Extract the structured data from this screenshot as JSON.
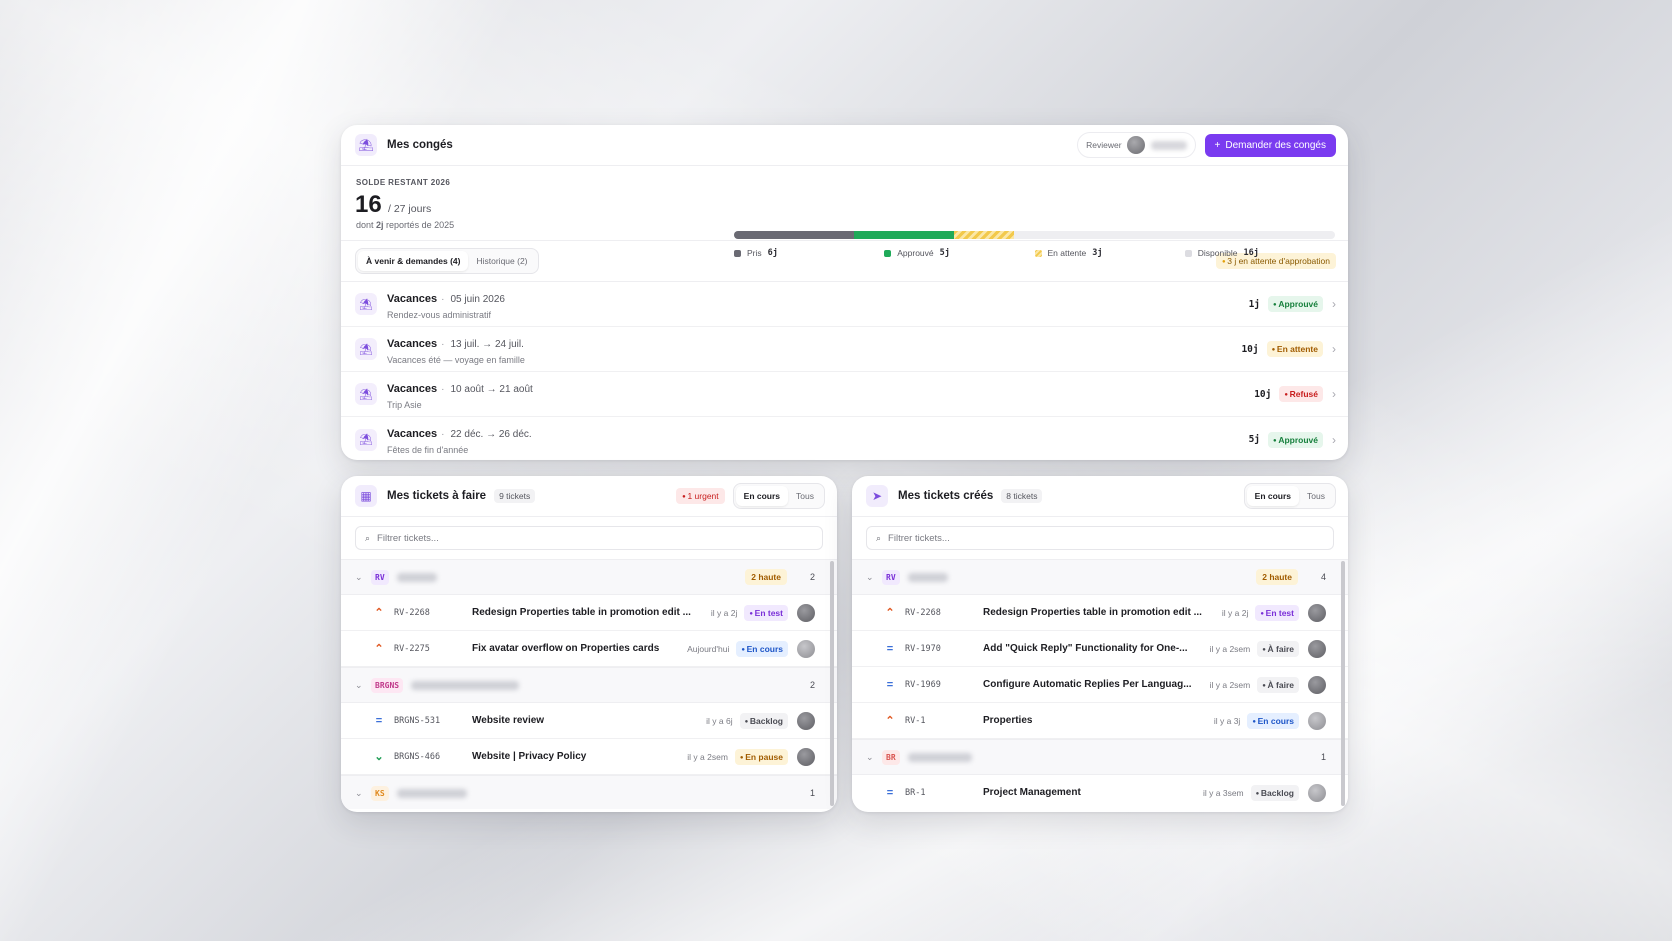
{
  "conges": {
    "title": "Mes congés",
    "reviewer_label": "Reviewer",
    "request_button": "Demander des congés",
    "balance": {
      "caption": "SOLDE RESTANT 2026",
      "remaining": "16",
      "total": "/ 27 jours",
      "carry_prefix": "dont ",
      "carry_value": "2j",
      "carry_suffix": " reportés de 2025"
    },
    "breakdown": [
      {
        "label": "Pris",
        "value": "6j",
        "days": 6,
        "color": "#6a6a73"
      },
      {
        "label": "Approuvé",
        "value": "5j",
        "days": 5,
        "color": "#1faa59"
      },
      {
        "label": "En attente",
        "value": "3j",
        "days": 3,
        "color": "#f2c94c"
      },
      {
        "label": "Disponible",
        "value": "16j",
        "days": 16,
        "color": "#e6e6ea"
      }
    ],
    "tabs": [
      "À venir & demandes (4)",
      "Historique (2)"
    ],
    "pending_note": "3 j en attente d'approbation",
    "requests": [
      {
        "type": "Vacances",
        "date": "05 juin 2026",
        "note": "Rendez-vous administratif",
        "days": "1j",
        "status": "Approuvé",
        "status_kind": "green"
      },
      {
        "type": "Vacances",
        "date": "13 juil. → 24 juil.",
        "note": "Vacances été — voyage en famille",
        "days": "10j",
        "status": "En attente",
        "status_kind": "amber"
      },
      {
        "type": "Vacances",
        "date": "10 août → 21 août",
        "note": "Trip Asie",
        "days": "10j",
        "status": "Refusé",
        "status_kind": "red"
      },
      {
        "type": "Vacances",
        "date": "22 déc. → 26 déc.",
        "note": "Fêtes de fin d'année",
        "days": "5j",
        "status": "Approuvé",
        "status_kind": "green"
      }
    ]
  },
  "todo": {
    "title": "Mes tickets à faire",
    "count": "9 tickets",
    "urgent": "1 urgent",
    "seg": [
      "En cours",
      "Tous"
    ],
    "search_placeholder": "Filtrer tickets...",
    "groups": [
      {
        "tag": "RV",
        "tag_color": "#7a2fd8",
        "tag_bg": "#f1e9fe",
        "high": "2 haute",
        "count": "2",
        "name_width": 40,
        "tickets": [
          {
            "prio": "up",
            "key": "RV-2268",
            "title": "Redesign Properties table in promotion edit ...",
            "time": "il y a 2j",
            "status": "En test",
            "kind": "purple",
            "avatar": "dark"
          },
          {
            "prio": "up",
            "key": "RV-2275",
            "title": "Fix avatar overflow on Properties cards",
            "time": "Aujourd'hui",
            "status": "En cours",
            "kind": "blue",
            "avatar": "light"
          }
        ]
      },
      {
        "tag": "BRGNS",
        "tag_color": "#c0398a",
        "tag_bg": "#fde7f3",
        "high": "",
        "count": "2",
        "name_width": 108,
        "tickets": [
          {
            "prio": "mid",
            "key": "BRGNS-531",
            "title": "Website review",
            "time": "il y a 6j",
            "status": "Backlog",
            "kind": "gray",
            "avatar": "dark"
          },
          {
            "prio": "down",
            "key": "BRGNS-466",
            "title": "Website | Privacy Policy",
            "time": "il y a 2sem",
            "status": "En pause",
            "kind": "amber",
            "avatar": "dark"
          }
        ]
      },
      {
        "tag": "KS",
        "tag_color": "#e08a1f",
        "tag_bg": "#fdf1e0",
        "high": "",
        "count": "1",
        "name_width": 70,
        "tickets": []
      }
    ]
  },
  "created": {
    "title": "Mes tickets créés",
    "count": "8 tickets",
    "seg": [
      "En cours",
      "Tous"
    ],
    "search_placeholder": "Filtrer tickets...",
    "groups": [
      {
        "tag": "RV",
        "tag_color": "#7a2fd8",
        "tag_bg": "#f1e9fe",
        "high": "2 haute",
        "count": "4",
        "name_width": 40,
        "tickets": [
          {
            "prio": "up",
            "key": "RV-2268",
            "title": "Redesign Properties table in promotion edit ...",
            "time": "il y a 2j",
            "status": "En test",
            "kind": "purple",
            "avatar": "dark"
          },
          {
            "prio": "mid",
            "key": "RV-1970",
            "title": "Add \"Quick Reply\" Functionality for One-...",
            "time": "il y a 2sem",
            "status": "À faire",
            "kind": "gray",
            "avatar": "dark"
          },
          {
            "prio": "mid",
            "key": "RV-1969",
            "title": "Configure Automatic Replies Per Languag...",
            "time": "il y a 2sem",
            "status": "À faire",
            "kind": "gray",
            "avatar": "dark"
          },
          {
            "prio": "up",
            "key": "RV-1",
            "title": "Properties",
            "time": "il y a 3j",
            "status": "En cours",
            "kind": "blue",
            "avatar": "light"
          }
        ]
      },
      {
        "tag": "BR",
        "tag_color": "#d9534f",
        "tag_bg": "#fde8e8",
        "high": "",
        "count": "1",
        "name_width": 64,
        "tickets": [
          {
            "prio": "mid",
            "key": "BR-1",
            "title": "Project Management",
            "time": "il y a 3sem",
            "status": "Backlog",
            "kind": "gray",
            "avatar": "light"
          }
        ]
      }
    ]
  },
  "icons": {
    "header_conges": "beach-umbrella-icon",
    "header_todo": "kanban-icon",
    "header_created": "send-icon",
    "search": "search-icon",
    "plus": "plus-icon",
    "chevron_right": "chevron-right-icon",
    "chevron_down": "chevron-down-icon"
  }
}
